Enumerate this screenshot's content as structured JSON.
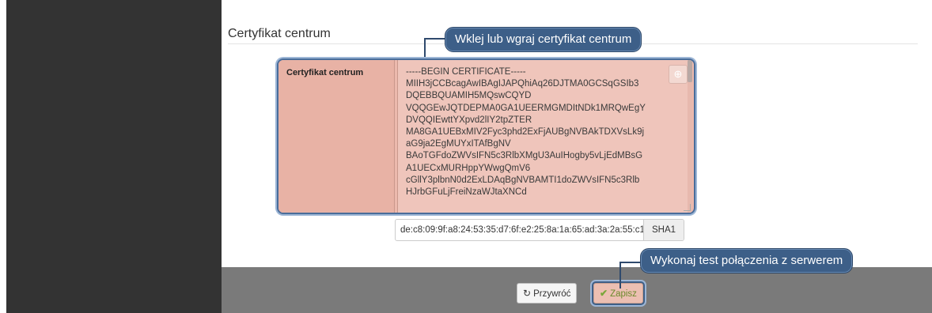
{
  "section": {
    "title": "Certyfikat centrum"
  },
  "callouts": {
    "top": "Wklej lub wgraj certyfikat centrum",
    "bottom": "Wykonaj test połączenia z serwerem"
  },
  "certificate": {
    "label": "Certyfikat centrum",
    "lines": [
      "-----BEGIN CERTIFICATE-----",
      "MIIH3jCCBcagAwIBAgIJAPQhiAq26DJTMA0GCSqGSIb3",
      "DQEBBQUAMIH5MQswCQYD",
      "VQQGEwJQTDEPMA0GA1UEERMGMDItNDk1MRQwEgY",
      "DVQQIEwttYXpvd2lIY2tpZTER",
      "MA8GA1UEBxMIV2Fyc3phd2ExFjAUBgNVBAkTDXVsLk9j",
      "aG9ja2EgMUYxITAfBgNV",
      "BAoTGFdoZWVsIFN5c3RlbXMgU3AuIHogby5vLjEdMBsG",
      "A1UECxMURHppYWwgQmV6",
      "cGllY3plbnN0d2ExLDAqBgNVBAMTI1doZWVsIFN5c3Rlb",
      "HJrbGFuLjFreiNzaWJtaXNCd"
    ],
    "upload_icon": "upload-icon"
  },
  "fingerprint": {
    "value": "de:c8:09:9f:a8:24:53:35:d7:6f:e2:25:8a:1a:65:ad:3a:2a:55:c1",
    "algorithm": "SHA1"
  },
  "footer": {
    "reset_label": "Przywróć",
    "save_label": "Zapisz",
    "reset_icon": "refresh-icon",
    "save_icon": "check-icon"
  }
}
